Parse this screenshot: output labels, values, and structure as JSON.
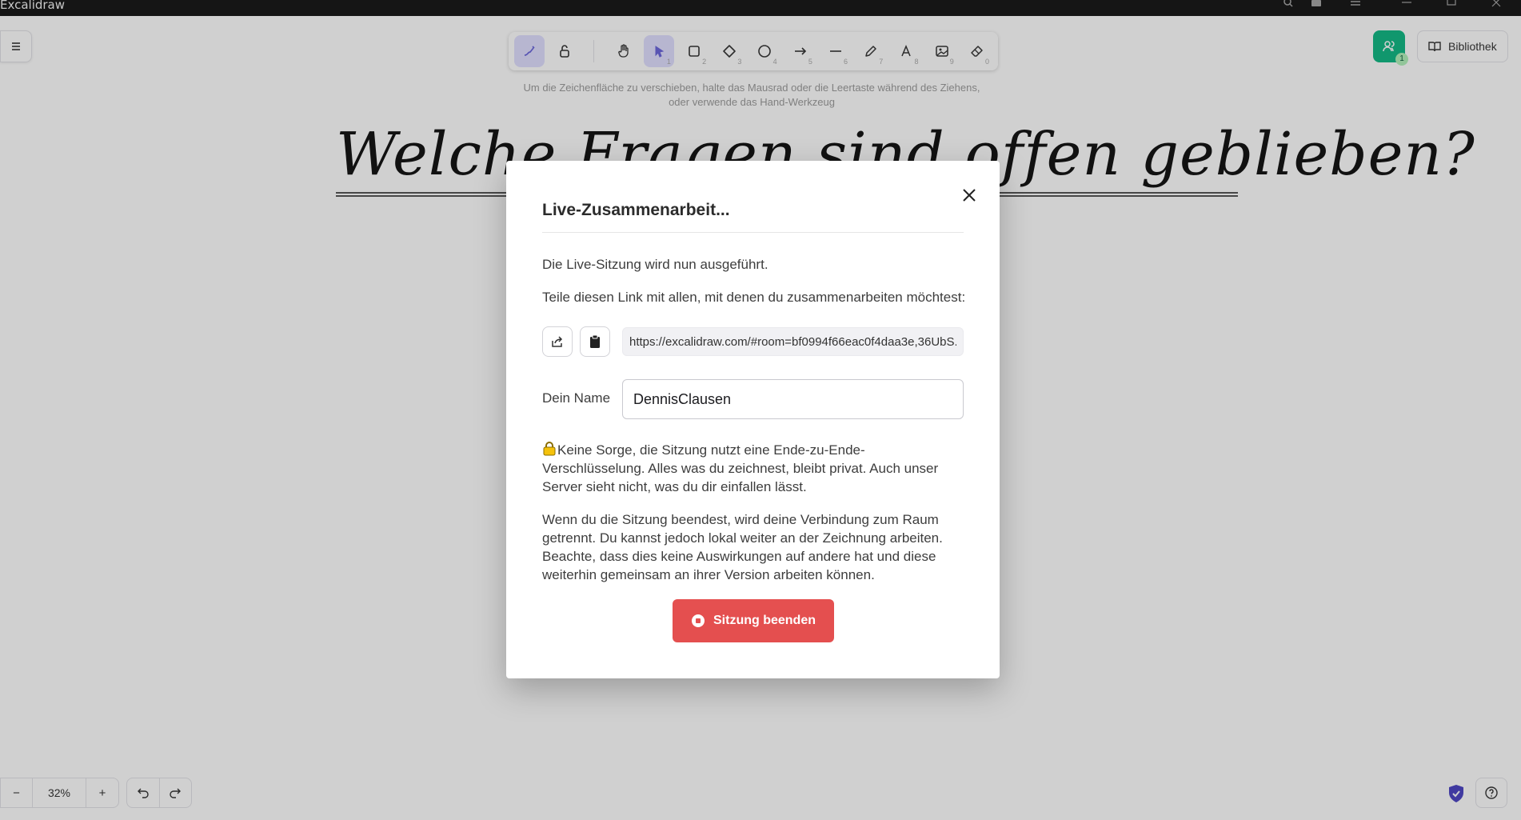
{
  "window": {
    "app_title": "Excalidraw"
  },
  "canvas": {
    "hint": "Um die Zeichenfläche zu verschieben, halte das Mausrad oder die Leertaste während des Ziehens, oder verwende das Hand-Werkzeug",
    "board_title": "Welche Fragen sind offen geblieben?"
  },
  "toolbar": {
    "tools": [
      {
        "name": "lock-tool",
        "icon": "lock-icon",
        "number": ""
      },
      {
        "name": "hand-tool",
        "icon": "hand-icon",
        "number": ""
      },
      {
        "name": "selection-tool",
        "icon": "pointer-icon",
        "number": "1"
      },
      {
        "name": "rectangle-tool",
        "icon": "rectangle-icon",
        "number": "2"
      },
      {
        "name": "diamond-tool",
        "icon": "diamond-icon",
        "number": "3"
      },
      {
        "name": "ellipse-tool",
        "icon": "ellipse-icon",
        "number": "4"
      },
      {
        "name": "arrow-tool",
        "icon": "arrow-icon",
        "number": "5"
      },
      {
        "name": "line-tool",
        "icon": "line-icon",
        "number": "6"
      },
      {
        "name": "draw-tool",
        "icon": "pencil-icon",
        "number": "7"
      },
      {
        "name": "text-tool",
        "icon": "text-icon",
        "number": "8"
      },
      {
        "name": "image-tool",
        "icon": "image-icon",
        "number": "9"
      },
      {
        "name": "eraser-tool",
        "icon": "eraser-icon",
        "number": "0"
      }
    ],
    "active_tool": "selection-tool"
  },
  "topright": {
    "collaborators_count": "1",
    "library_label": "Bibliothek"
  },
  "footer": {
    "zoom_minus": "−",
    "zoom_level": "32%",
    "zoom_plus": "+"
  },
  "modal": {
    "title": "Live-Zusammenarbeit...",
    "running_text": "Die Live-Sitzung wird nun ausgeführt.",
    "share_text": "Teile diesen Link mit allen, mit denen du zusammenarbeiten möchtest:",
    "link_value": "https://excalidraw.com/#room=bf0994f66eac0f4daa3e,36UbS...",
    "name_label": "Dein Name",
    "name_value": "DennisClausen",
    "privacy_text": "Keine Sorge, die Sitzung nutzt eine Ende-zu-Ende-Verschlüsselung. Alles was du zeichnest, bleibt privat. Auch unser Server sieht nicht, was du dir einfallen lässt.",
    "end_text": "Wenn du die Sitzung beendest, wird deine Verbindung zum Raum getrennt. Du kannst jedoch lokal weiter an der Zeichnung arbeiten. Beachte, dass dies keine Auswirkungen auf andere hat und diese weiterhin gemeinsam an ihrer Version arbeiten können.",
    "stop_label": "Sitzung beenden"
  },
  "colors": {
    "accent": "#6965db",
    "collab_green": "#0fb884",
    "stop_red": "#e03131"
  }
}
